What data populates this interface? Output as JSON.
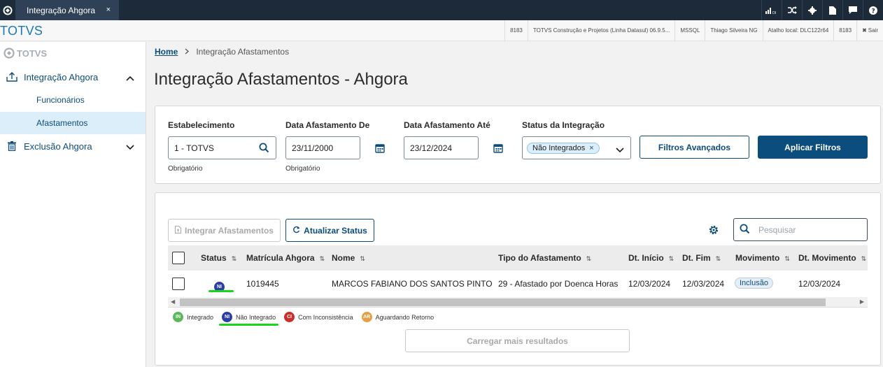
{
  "topbar": {
    "tab_label": "Integração Ahgora",
    "tab_close": "×",
    "dl_label": "DI"
  },
  "infobar": {
    "brand": "TOTVS",
    "cells": [
      "8183",
      "TOTVS Construção e Projetos (Linha Datasul) 06.9.5...",
      "MSSQL",
      "Thiago Silveira NG",
      "Atalho local: DLC122r64",
      "8183",
      "Sair"
    ]
  },
  "sidebar": {
    "logo_text": "TOTVS",
    "items": [
      {
        "label": "Integração Ahgora",
        "icon": "upload-icon"
      },
      {
        "label": "Funcionários"
      },
      {
        "label": "Afastamentos"
      },
      {
        "label": "Exclusão Ahgora",
        "icon": "trash-icon"
      }
    ]
  },
  "breadcrumb": {
    "home": "Home",
    "current": "Integração Afastamentos"
  },
  "page_title": "Integração Afastamentos - Ahgora",
  "filters": {
    "estabelecimento": {
      "label": "Estabelecimento",
      "value": "1 - TOTVS",
      "help": "Obrigatório"
    },
    "data_de": {
      "label": "Data Afastamento De",
      "value": "23/11/2000",
      "help": "Obrigatório"
    },
    "data_ate": {
      "label": "Data Afastamento Até",
      "value": "23/12/2024"
    },
    "status": {
      "label": "Status da Integração",
      "chip": "Não Integrados",
      "chip_remove": "×"
    },
    "advanced_btn": "Filtros Avançados",
    "apply_btn": "Aplicar Filtros"
  },
  "table_actions": {
    "integrar_btn": "Integrar Afastamentos",
    "atualizar_btn": "Atualizar Status",
    "search_placeholder": "Pesquisar"
  },
  "table": {
    "columns": [
      "Status",
      "Matrícula Ahgora",
      "Nome",
      "Tipo do Afastamento",
      "Dt. Início",
      "Dt. Fim",
      "Movimento",
      "Dt. Movimento"
    ],
    "sort_glyph": "⇅",
    "rows": [
      {
        "status_badge": "NI",
        "matricula": "1019445",
        "nome": "MARCOS FABIANO DOS SANTOS PINTO",
        "tipo": "29 - Afastado por Doenca Horas",
        "dt_inicio": "12/03/2024",
        "dt_fim": "12/03/2024",
        "movimento": "Inclusão",
        "dt_movimento": "12/03/2024"
      }
    ]
  },
  "legend": [
    {
      "badge": "IN",
      "label": "Integrado",
      "color": "#5cb85c"
    },
    {
      "badge": "NI",
      "label": "Não Integrado",
      "color": "#2b3ea1"
    },
    {
      "badge": "CI",
      "label": "Com Inconsistência",
      "color": "#c9302c"
    },
    {
      "badge": "AR",
      "label": "Aguardando Retorno",
      "color": "#e5a046"
    }
  ],
  "load_more": "Carregar mais resultados",
  "colors": {
    "primary": "#0b4d7d",
    "brand": "#1a7ab8",
    "topbar": "#1c2a39",
    "highlight": "#19d519"
  }
}
